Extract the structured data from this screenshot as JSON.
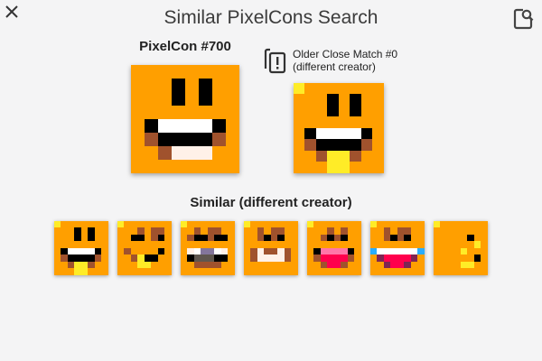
{
  "window": {
    "title": "Similar PixelCons Search",
    "close_icon": "close-icon",
    "search_icon": "search-icon"
  },
  "main": {
    "label": "PixelCon #700"
  },
  "match": {
    "icon": "copy-icon",
    "line1": "Older Close Match #0",
    "line2": "(different creator)"
  },
  "similar": {
    "title": "Similar (different creator)",
    "count": 7
  },
  "palette": {
    "o": "#ff9f00",
    "k": "#000000",
    "w": "#ffffff",
    "b": "#a0522d",
    "y": "#ffec27",
    "p": "#fff1e8",
    "g": "#5f574f",
    "i": "#83769c",
    "r": "#ff004d",
    "m": "#7e2553",
    "n": "#ff77a8",
    "c": "#29adff"
  },
  "pixelcons": {
    "main": [
      "oooooooo",
      "oookokoo",
      "oookokoo",
      "oooooooo",
      "okwwwwko",
      "obkkkkbo",
      "oobpppoo",
      "oooooooo"
    ],
    "match": [
      "yooooooo",
      "oookokoo",
      "oookokoo",
      "oooooooo",
      "okwwwwko",
      "obkkkkbo",
      "oobyyboo",
      "oooyyooo"
    ],
    "thumbs": [
      [
        "yooooooo",
        "oookokoo",
        "oookokoo",
        "oooooooo",
        "okwwwwko",
        "obkkkkbo",
        "oobyyboo",
        "oooyyooo"
      ],
      [
        "yooooooo",
        "ooobobbo",
        "ookkobko",
        "oooooooo",
        "obooooko",
        "oobykkoo",
        "oooyyooo",
        "oooooooo"
      ],
      [
        "yooooooo",
        "oobobboo",
        "obkkbkko",
        "oooooooo",
        "opwiiwpo",
        "okgggkko",
        "oobbbboo",
        "oooooooo"
      ],
      [
        "yooooooo",
        "oobobboo",
        "oobkbkoo",
        "oooooooo",
        "obpbbpbo",
        "obppppbo",
        "oooooooo",
        "oooooooo"
      ],
      [
        "yooooooo",
        "oooboboo",
        "oobkbkoo",
        "oooooooo",
        "oknnnnko",
        "obrrrrbo",
        "oobrrboo",
        "oooooooo"
      ],
      [
        "yooooooo",
        "oobobboo",
        "oobkbkoo",
        "oooooooo",
        "cwwwwwwc",
        "omrrrrmo",
        "oomrrmoo",
        "oooooooo"
      ],
      [
        "yooooooo",
        "oooooooo",
        "oooookoo",
        "ooooooyo",
        "ooooyooo",
        "ooooooko",
        "ooooyyoo",
        "oooooooo"
      ]
    ]
  }
}
